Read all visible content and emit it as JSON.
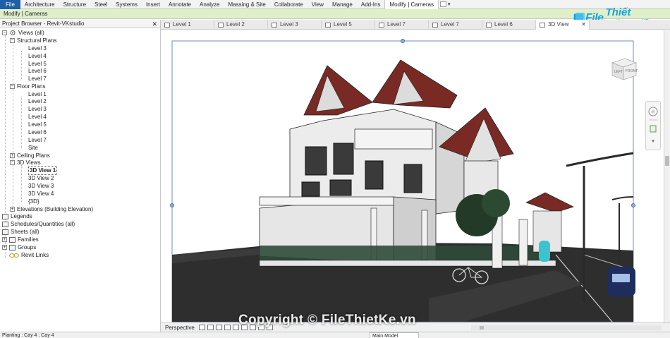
{
  "ribbon": {
    "tabs": [
      {
        "label": "File"
      },
      {
        "label": "Architecture"
      },
      {
        "label": "Structure"
      },
      {
        "label": "Steel"
      },
      {
        "label": "Systems"
      },
      {
        "label": "Insert"
      },
      {
        "label": "Annotate"
      },
      {
        "label": "Analyze"
      },
      {
        "label": "Massing & Site"
      },
      {
        "label": "Collaborate"
      },
      {
        "label": "View"
      },
      {
        "label": "Manage"
      },
      {
        "label": "Add-Ins"
      },
      {
        "label": "Modify | Cameras"
      }
    ],
    "active_index": 13
  },
  "context_bar": {
    "label": "Modify | Cameras"
  },
  "logo": {
    "part1": "File",
    "part2": "Thiết Kế",
    "part3": ".vn"
  },
  "project_browser": {
    "title": "Project Browser - Revit-VKstudio",
    "close": "✕",
    "tree": {
      "views_all": "Views (all)",
      "structural_plans": "Structural Plans",
      "structural_levels": [
        "Level 3",
        "Level 4",
        "Level 5",
        "Level 6",
        "Level 7"
      ],
      "floor_plans": "Floor Plans",
      "floor_levels": [
        "Level 1",
        "Level 2",
        "Level 3",
        "Level 4",
        "Level 5",
        "Level 6",
        "Level 7",
        "Site"
      ],
      "ceiling_plans": "Ceiling Plans",
      "views_3d": "3D Views",
      "views_3d_items": [
        "3D View 1",
        "3D View 2",
        "3D View 3",
        "3D View 4",
        "{3D}"
      ],
      "elevations": "Elevations (Building Elevation)",
      "legends": "Legends",
      "schedules": "Schedules/Quantities (all)",
      "sheets": "Sheets (all)",
      "families": "Families",
      "groups": "Groups",
      "revit_links": "Revit Links"
    }
  },
  "view_tabs": [
    {
      "label": "Level 1"
    },
    {
      "label": "Level 2"
    },
    {
      "label": "Level 3"
    },
    {
      "label": "Level 5"
    },
    {
      "label": "Level 7"
    },
    {
      "label": "Level 7"
    },
    {
      "label": "Level 6"
    },
    {
      "label": "3D View"
    }
  ],
  "view_cube": {
    "left": "LEFT",
    "front": "FRONT"
  },
  "view_control": {
    "label": "Perspective"
  },
  "watermark": "Copyright © FileThietKe.vn",
  "status_bar": {
    "text": "Planting : Cay 4 : Cay 4",
    "model": "Main Model"
  },
  "colors": {
    "accent": "#1f5fa8",
    "context": "#dff0c8",
    "roof": "#7a2a24",
    "ground": "#2d2d2d",
    "logo": "#1aa0e0"
  }
}
